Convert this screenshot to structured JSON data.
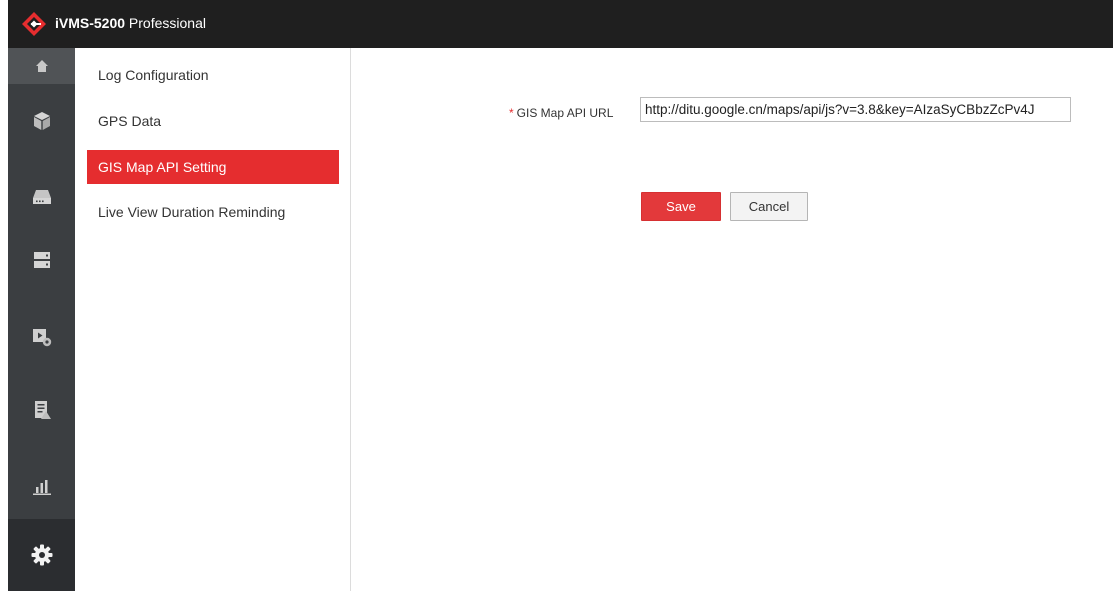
{
  "app": {
    "logo_icon": "ivms-diamond-logo",
    "title_bold": "iVMS-5200",
    "title_rest": " Professional"
  },
  "iconbar": {
    "items": [
      {
        "name": "home-icon",
        "active": false
      },
      {
        "name": "cube-icon",
        "active": false
      },
      {
        "name": "device-icon",
        "active": false
      },
      {
        "name": "storage-icon",
        "active": false
      },
      {
        "name": "video-settings-icon",
        "active": false
      },
      {
        "name": "event-log-icon",
        "active": false
      },
      {
        "name": "statistics-icon",
        "active": false
      },
      {
        "name": "gear-icon",
        "active": true
      }
    ]
  },
  "sidebar": {
    "items": [
      {
        "label": "Log Configuration",
        "active": false
      },
      {
        "label": "GPS Data",
        "active": false
      },
      {
        "label": "GIS Map API Setting",
        "active": true
      },
      {
        "label": "Live View Duration Reminding",
        "active": false
      }
    ]
  },
  "form": {
    "required_mark": "*",
    "url_label": "GIS Map API URL",
    "url_value": "http://ditu.google.cn/maps/api/js?v=3.8&key=AIzaSyCBbzZcPv4J",
    "save_label": "Save",
    "cancel_label": "Cancel"
  },
  "colors": {
    "accent": "#e52d2f",
    "titlebar": "#1f1f1f",
    "iconbar": "#3b3e41"
  }
}
